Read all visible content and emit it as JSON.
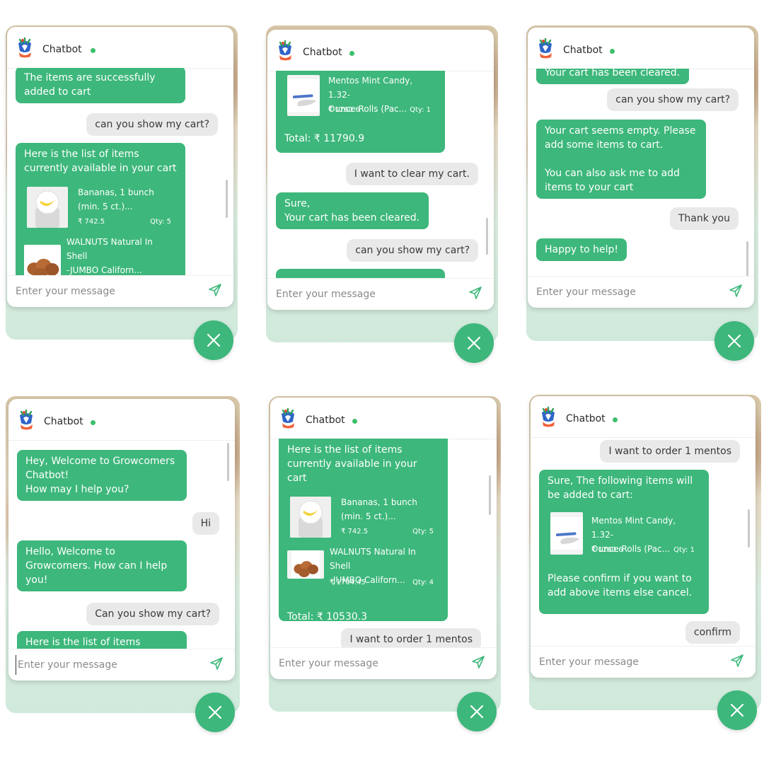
{
  "chat": {
    "title": "Chatbot",
    "input_placeholder": "Enter your message",
    "currency": "₹"
  },
  "panel1": {
    "m1": [
      "The items are successfully",
      "added to cart"
    ],
    "m2": "can you show my cart?",
    "m3": [
      "Here is the list of items",
      "currently available in your cart"
    ],
    "item1": {
      "name": [
        "Bananas, 1 bunch",
        "(min. 5 ct.)..."
      ],
      "price": "₹ 742.5",
      "qty": "Qty: 5"
    },
    "item2": {
      "name": [
        "WALNUTS Natural In Shell",
        "-JUMBO Californ..."
      ]
    }
  },
  "panel2": {
    "item": {
      "name": [
        "Mentos Mint Candy, 1.32-",
        "Ounce Rolls (Pac..."
      ],
      "price": "₹ 1260.6",
      "qty": "Qty: 1"
    },
    "total": "Total: ₹ 11790.9",
    "m1": "I want to clear my cart.",
    "m2": [
      "Sure,",
      "Your cart has been cleared."
    ],
    "m3": "can you show my cart?"
  },
  "panel3": {
    "m0": "Your cart has been cleared.",
    "m1": "can you show my cart?",
    "m2": [
      "Your cart seems empty. Please",
      "add some items to cart.",
      "",
      "You can also ask me to add",
      "items to your cart"
    ],
    "m3": "Thank you",
    "m4": "Happy to help!"
  },
  "panel4": {
    "m1": [
      "Hey, Welcome to Growcomers",
      "Chatbot!",
      "How may I help you?"
    ],
    "m2": "Hi",
    "m3": [
      "Hello, Welcome to",
      "Growcomers. How can I help",
      "you!"
    ],
    "m4": "Can you show my cart?",
    "m5": "Here is the list of items"
  },
  "panel5": {
    "m1": [
      "Here is the list of items",
      "currently available in your cart"
    ],
    "item1": {
      "name": [
        "Bananas, 1 bunch",
        "(min. 5 ct.)..."
      ],
      "price": "₹ 742.5",
      "qty": "Qty: 5"
    },
    "item2": {
      "name": [
        "WALNUTS Natural In Shell",
        "-JUMBO Californ..."
      ],
      "price": "₹ 1704.45",
      "qty": "Qty: 4"
    },
    "total": "Total: ₹ 10530.3",
    "m2": "I want to order 1 mentos"
  },
  "panel6": {
    "m1": "I want to order 1 mentos",
    "m2_top": [
      "Sure, The following items will",
      "be added to cart:"
    ],
    "item": {
      "name": [
        "Mentos Mint Candy, 1.32-",
        "Ounce Rolls (Pac..."
      ],
      "price": "₹ 1260.6",
      "qty": "Qty: 1"
    },
    "m2_bottom": [
      "Please confirm if you want to",
      "add above items else cancel."
    ],
    "m3": "confirm"
  },
  "colors": {
    "bot_bubble": "#3db77b",
    "user_bubble": "#e9e9e9",
    "online_dot": "#3cbf6d"
  }
}
